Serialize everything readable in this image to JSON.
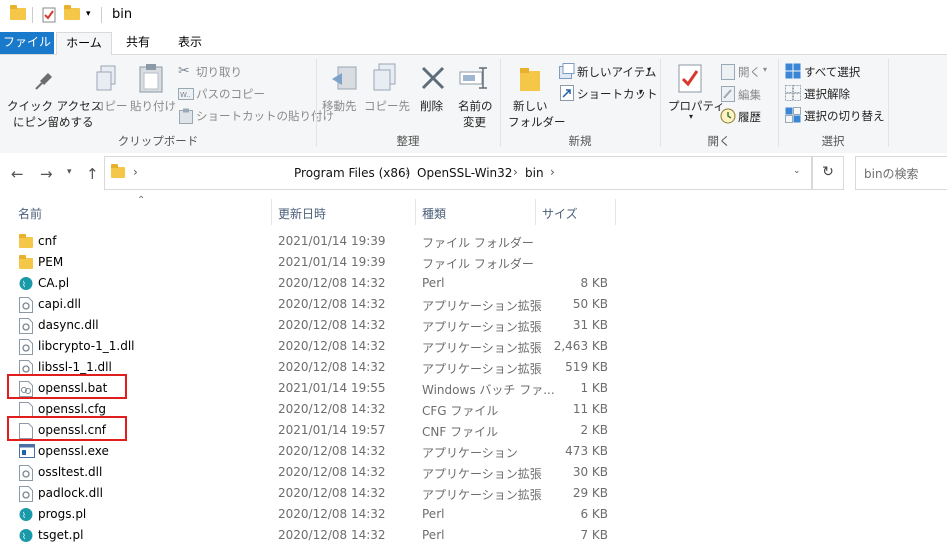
{
  "window": {
    "title": "bin"
  },
  "ribbon_tabs": [
    "ファイル",
    "ホーム",
    "共有",
    "表示"
  ],
  "ribbon": {
    "clipboard": {
      "pin_label_1": "クイック アクセス",
      "pin_label_2": "にピン留めする",
      "copy": "コピー",
      "paste": "貼り付け",
      "cut": "切り取り",
      "copy_path": "パスのコピー",
      "paste_shortcut": "ショートカットの貼り付け",
      "group": "クリップボード"
    },
    "organize": {
      "move_to": "移動先",
      "copy_to": "コピー先",
      "delete": "削除",
      "rename_1": "名前の",
      "rename_2": "変更",
      "group": "整理"
    },
    "new": {
      "new_folder_1": "新しい",
      "new_folder_2": "フォルダー",
      "new_item": "新しいアイテム",
      "shortcut": "ショートカット",
      "group": "新規"
    },
    "open": {
      "properties": "プロパティ",
      "open": "開く",
      "edit": "編集",
      "history": "履歴",
      "group": "開く"
    },
    "select": {
      "select_all": "すべて選択",
      "select_none": "選択解除",
      "invert": "選択の切り替え",
      "group": "選択"
    }
  },
  "address": {
    "crumbs": [
      "Program Files (x86)",
      "OpenSSL-Win32",
      "bin"
    ],
    "search_placeholder": "binの検索"
  },
  "columns": {
    "name": "名前",
    "date": "更新日時",
    "type": "種類",
    "size": "サイズ"
  },
  "files": [
    {
      "name": "cnf",
      "date": "2021/01/14 19:39",
      "type": "ファイル フォルダー",
      "size": "",
      "icon": "folder"
    },
    {
      "name": "PEM",
      "date": "2021/01/14 19:39",
      "type": "ファイル フォルダー",
      "size": "",
      "icon": "folder"
    },
    {
      "name": "CA.pl",
      "date": "2020/12/08 14:32",
      "type": "Perl",
      "size": "8 KB",
      "icon": "perl"
    },
    {
      "name": "capi.dll",
      "date": "2020/12/08 14:32",
      "type": "アプリケーション拡張",
      "size": "50 KB",
      "icon": "dll"
    },
    {
      "name": "dasync.dll",
      "date": "2020/12/08 14:32",
      "type": "アプリケーション拡張",
      "size": "31 KB",
      "icon": "dll"
    },
    {
      "name": "libcrypto-1_1.dll",
      "date": "2020/12/08 14:32",
      "type": "アプリケーション拡張",
      "size": "2,463 KB",
      "icon": "dll"
    },
    {
      "name": "libssl-1_1.dll",
      "date": "2020/12/08 14:32",
      "type": "アプリケーション拡張",
      "size": "519 KB",
      "icon": "dll"
    },
    {
      "name": "openssl.bat",
      "date": "2021/01/14 19:55",
      "type": "Windows バッチ ファ...",
      "size": "1 KB",
      "icon": "bat"
    },
    {
      "name": "openssl.cfg",
      "date": "2020/12/08 14:32",
      "type": "CFG ファイル",
      "size": "11 KB",
      "icon": "file"
    },
    {
      "name": "openssl.cnf",
      "date": "2021/01/14 19:57",
      "type": "CNF ファイル",
      "size": "2 KB",
      "icon": "file"
    },
    {
      "name": "openssl.exe",
      "date": "2020/12/08 14:32",
      "type": "アプリケーション",
      "size": "473 KB",
      "icon": "exe"
    },
    {
      "name": "ossltest.dll",
      "date": "2020/12/08 14:32",
      "type": "アプリケーション拡張",
      "size": "30 KB",
      "icon": "dll"
    },
    {
      "name": "padlock.dll",
      "date": "2020/12/08 14:32",
      "type": "アプリケーション拡張",
      "size": "29 KB",
      "icon": "dll"
    },
    {
      "name": "progs.pl",
      "date": "2020/12/08 14:32",
      "type": "Perl",
      "size": "6 KB",
      "icon": "perl"
    },
    {
      "name": "tsget.pl",
      "date": "2020/12/08 14:32",
      "type": "Perl",
      "size": "7 KB",
      "icon": "perl"
    }
  ],
  "highlighted": [
    "openssl.bat",
    "openssl.cnf"
  ],
  "colors": {
    "accent": "#1979ca",
    "highlight": "#e11d1d",
    "folder": "#f5c748"
  }
}
